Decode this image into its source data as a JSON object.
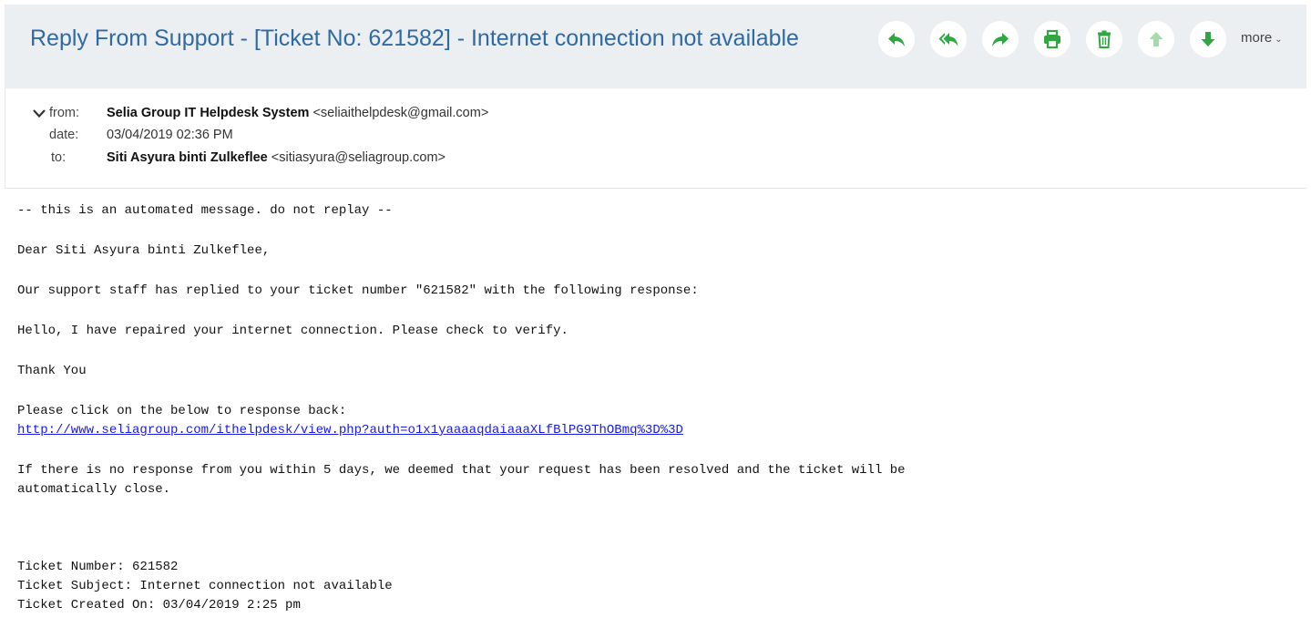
{
  "email": {
    "subject": "Reply From Support - [Ticket No: 621582] - Internet connection not available",
    "toolbar": {
      "icons": [
        "reply-icon",
        "reply-all-icon",
        "forward-icon",
        "print-icon",
        "delete-icon",
        "previous-icon",
        "next-icon"
      ],
      "more_label": "more",
      "icon_color": "#31a642",
      "disabled_color": "#a8d9b0"
    },
    "from": {
      "key": "from:",
      "name": "Selia Group IT Helpdesk System",
      "address": "<seliaithelpdesk@gmail.com>"
    },
    "date": {
      "key": "date:",
      "value": "03/04/2019 02:36 PM"
    },
    "to": {
      "key": "to:",
      "name": "Siti Asyura binti Zulkeflee",
      "address": "<sitiasyura@seliagroup.com>"
    },
    "body": {
      "automated_notice": "-- this is an automated message. do not replay --",
      "greeting": "Dear Siti Asyura binti Zulkeflee,",
      "intro": "Our support staff has replied to your ticket number \"621582\" with the following response:",
      "response": "Hello, I have repaired your internet connection. Please check to verify.",
      "thanks": "Thank You",
      "click_prompt": "Please click on the below to response back:",
      "link": "http://www.seliagroup.com/ithelpdesk/view.php?auth=o1x1yaaaaqdaiaaaXLfBlPG9ThOBmq%3D%3D",
      "notice_line1": "If there is no response from you within 5 days, we deemed that your request has been resolved and the ticket will be",
      "notice_line2": "automatically close.",
      "ticket_number": "Ticket Number: 621582",
      "ticket_subject": "Ticket Subject: Internet connection not available",
      "ticket_created": "Ticket Created On: 03/04/2019 2:25 pm"
    }
  }
}
